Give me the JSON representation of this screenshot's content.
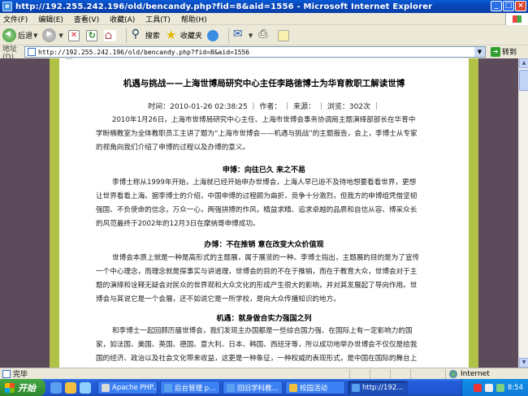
{
  "window": {
    "title": "http://192.255.242.196/old/bencandy.php?fid=8&aid=1556 - Microsoft Internet Explorer",
    "minimize": "_",
    "maximize": "□",
    "close": "×"
  },
  "menu": [
    "文件(F)",
    "编辑(E)",
    "查看(V)",
    "收藏(A)",
    "工具(T)",
    "帮助(H)"
  ],
  "toolbar": {
    "back_label": "后退",
    "search_label": "搜索",
    "favorites_label": "收藏夹"
  },
  "address": {
    "label": "地址(D)",
    "url": "http://192.255.242.196/old/bencandy.php?fid=8&aid=1556",
    "go_label": "转到"
  },
  "article": {
    "breadcrumb": "...",
    "title": "机遇与挑战——上海世博局研究中心主任李路徳博士为华育教职工解读世博",
    "meta": "时间：2010-01-26 02:38:25 ｜ 作者： ｜ 来源： ｜ 浏览：302次 ｜",
    "intro": "2010年1月26日，上海市世博局研究中心主任、上海市世博会事务协调局主题演绎部部长在华育中学盼楠教室为全体教职员工主讲了题为“上海市世博会——机遇与挑战”的主题报告，会上，李博士从专家的视角向我们介绍了申博的过程以及办博的意义。",
    "section1_title": "申博：向往已久 来之不易",
    "section1_text": "李博士称从1999年开始，上海就已经开始申办世博会，上海人早已迫不及待地想要看看世界，更想让世界看看上海。据李博士的介绍，中国申博的过程颇为曲折，竞争十分激烈，但我方的申博组凭借坚韧强国、不负使命的信念，万众一心，两强拼搏的作风，精益求精、追求卓越的品质和自信从容、博采众长的风范最终于2002年的12月3日在摩纳哥申博成功。",
    "section2_title": "办博：不在推销 意在改变大众价值观",
    "section2_text": "世博会本质上就是一种是高形式的主题展，属于展览的一种。李博士指出，主题展的目的是为了宣传一个中心理念，而理念就是探事实与讲道理，世博会的目的不在于推销，而在于教育大众，世博会对于主题的演绎和诠释无疑会对民众的世界观和大众文化的形成产生很大的影响，并对其发展起了导向作用。世博会与其说它是一个会展，还不如说它是一所学校，是向大众传播知识的地方。",
    "section3_title": "机遇：就身做合实力强国之列",
    "section3_text": "和李博士一起回顾历届世博会，我们发现主办国都是一些综合国力强、在国际上有一定影响力的国家，如法国、美国、英国、德国、意大利、日本、韩国、西班牙等，所以成功地举办世博会不仅仅是给我国的经济、政治以及社会文化带来收益，这更是一种象征，一种权威的表现形式，是中国在国际的舞台上扮演着重要角色的体现，这表明中国真正大步在世界中国力量大的与中国……"
  },
  "status": {
    "text": "完毕",
    "zone": "Internet"
  },
  "taskbar": {
    "start_label": "开始",
    "tasks": [
      "Apache PHP...",
      "后台管理 p...",
      "回旧学科教...",
      "校园活动",
      "http://192..."
    ],
    "clock": "8:54"
  },
  "colors": {
    "page_border": "#b2c246",
    "viewport_bg": "#5b4b5b",
    "titlebar": "#0846b8",
    "taskbar": "#245edb",
    "start": "#389638"
  }
}
